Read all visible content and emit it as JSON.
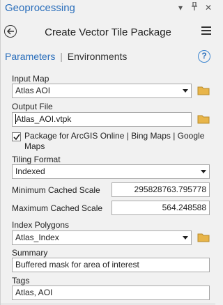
{
  "pane": {
    "title": "Geoprocessing",
    "icons": [
      "pin-icon",
      "autohide-icon",
      "close-icon"
    ]
  },
  "tool": {
    "title": "Create Vector Tile Package",
    "back_icon": "back-arrow-icon",
    "menu_icon": "hamburger-menu-icon"
  },
  "tabs": {
    "active": "Parameters",
    "separator": "|",
    "inactive": "Environments",
    "help": "?"
  },
  "form": {
    "input_map": {
      "label": "Input Map",
      "value": "Atlas AOI"
    },
    "output_file": {
      "label": "Output File",
      "value": "Atlas_AOI.vtpk"
    },
    "package_online": {
      "label": "Package for ArcGIS Online | Bing Maps | Google Maps",
      "checked": true
    },
    "tiling_format": {
      "label": "Tiling Format",
      "value": "Indexed"
    },
    "min_scale": {
      "label": "Minimum Cached Scale",
      "value": "295828763.795778"
    },
    "max_scale": {
      "label": "Maximum Cached Scale",
      "value": "564.248588"
    },
    "index_polygons": {
      "label": "Index Polygons",
      "value": "Atlas_Index"
    },
    "summary": {
      "label": "Summary",
      "value": "Buffered mask for area of interest"
    },
    "tags": {
      "label": "Tags",
      "value": "Atlas, AOI"
    }
  },
  "colors": {
    "accent": "#2a6ebb",
    "folder": "#e8b54a",
    "background": "#f1f1f1"
  }
}
